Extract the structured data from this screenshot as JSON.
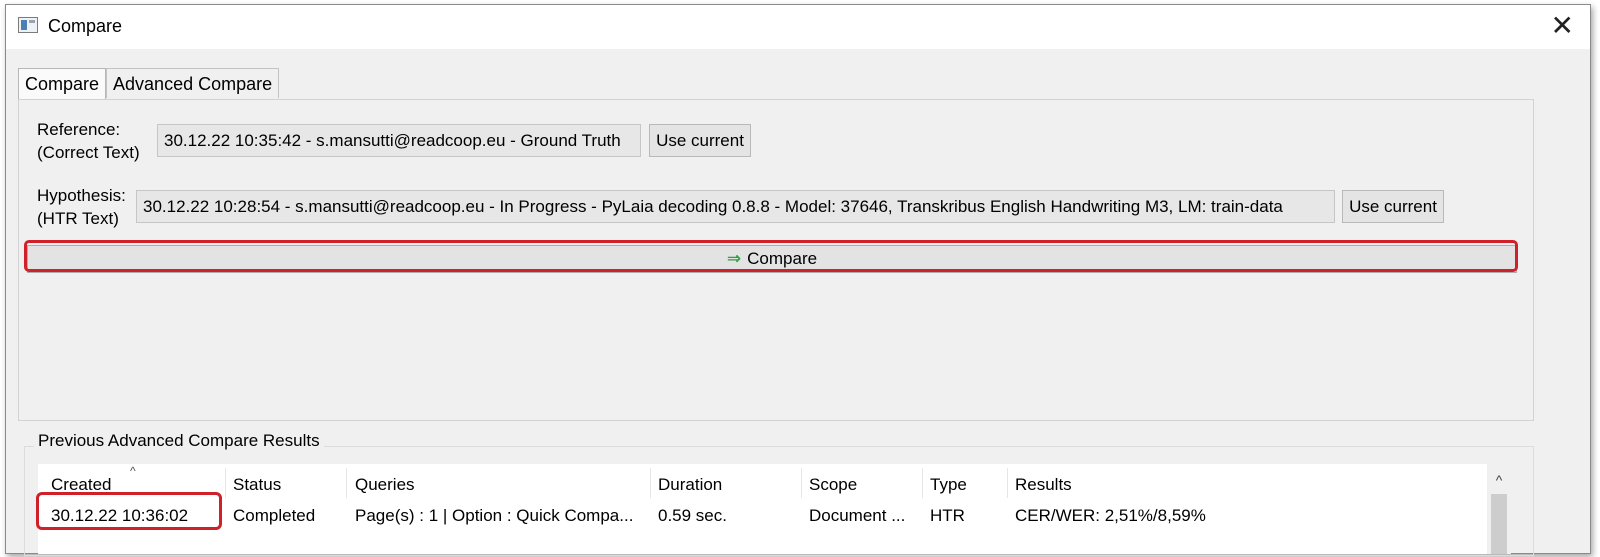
{
  "window": {
    "title": "Compare",
    "close_glyph": "✕"
  },
  "tabs": [
    {
      "label": "Compare",
      "active": true
    },
    {
      "label": "Advanced Compare",
      "active": false
    }
  ],
  "reference": {
    "label_line1": "Reference:",
    "label_line2": "(Correct Text)",
    "value": "30.12.22 10:35:42 - s.mansutti@readcoop.eu - Ground Truth",
    "use_current": "Use current"
  },
  "hypothesis": {
    "label_line1": "Hypothesis:",
    "label_line2": "(HTR Text)",
    "value": "30.12.22 10:28:54 - s.mansutti@readcoop.eu - In Progress - PyLaia decoding 0.8.8 - Model: 37646, Transkribus English Handwriting M3, LM: train-data",
    "use_current": "Use current"
  },
  "compare_button": {
    "arrow": "⇒",
    "label": "Compare"
  },
  "results": {
    "title": "Previous Advanced Compare Results",
    "columns": [
      "Created",
      "Status",
      "Queries",
      "Duration",
      "Scope",
      "Type",
      "Results"
    ],
    "rows": [
      [
        "30.12.22 10:36:02",
        "Completed",
        "Page(s) : 1 | Option : Quick Compa...",
        "0.59 sec.",
        "Document ...",
        "HTR",
        "CER/WER: 2,51%/8,59%"
      ]
    ],
    "sort_caret": "^",
    "scroll_up": "^"
  },
  "colors": {
    "highlight": "#d0202a",
    "arrow": "#2ea043"
  }
}
